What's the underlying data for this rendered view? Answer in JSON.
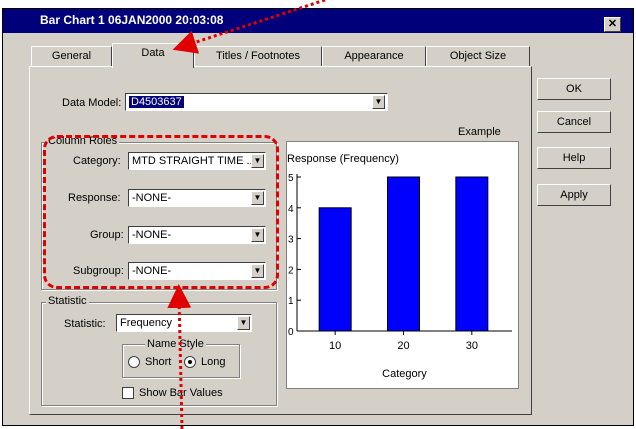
{
  "window": {
    "title": "Bar Chart 1 06JAN2000 20:03:08",
    "close_glyph": "✕"
  },
  "tabs": [
    {
      "label": "General",
      "active": false
    },
    {
      "label": "Data",
      "active": true
    },
    {
      "label": "Titles / Footnotes",
      "active": false
    },
    {
      "label": "Appearance",
      "active": false
    },
    {
      "label": "Object Size",
      "active": false
    }
  ],
  "data_model": {
    "label": "Data Model:",
    "value": "D4503637"
  },
  "column_roles": {
    "title": "Column Roles",
    "category": {
      "label": "Category:",
      "value": "MTD STRAIGHT TIME ..."
    },
    "response": {
      "label": "Response:",
      "value": "-NONE-"
    },
    "group": {
      "label": "Group:",
      "value": "-NONE-"
    },
    "subgroup": {
      "label": "Subgroup:",
      "value": "-NONE-"
    }
  },
  "statistic": {
    "title": "Statistic",
    "label": "Statistic:",
    "value": "Frequency",
    "name_style": {
      "title": "Name Style",
      "short": "Short",
      "long": "Long",
      "selected": "long"
    },
    "show_bar_values": {
      "label": "Show Bar Values",
      "checked": false
    }
  },
  "example": {
    "label": "Example",
    "chart_data": {
      "type": "bar",
      "title": "Response (Frequency)",
      "xlabel": "Category",
      "ylabel": "",
      "categories": [
        "10",
        "20",
        "30"
      ],
      "values": [
        4,
        5,
        5
      ],
      "ylim": [
        0,
        5
      ],
      "yticks": [
        "0",
        "1",
        "2",
        "3",
        "4",
        "5"
      ],
      "bar_color": "#0000ff"
    }
  },
  "buttons": {
    "ok": "OK",
    "cancel": "Cancel",
    "help": "Help",
    "apply": "Apply"
  },
  "annotation_color": "#e00000"
}
